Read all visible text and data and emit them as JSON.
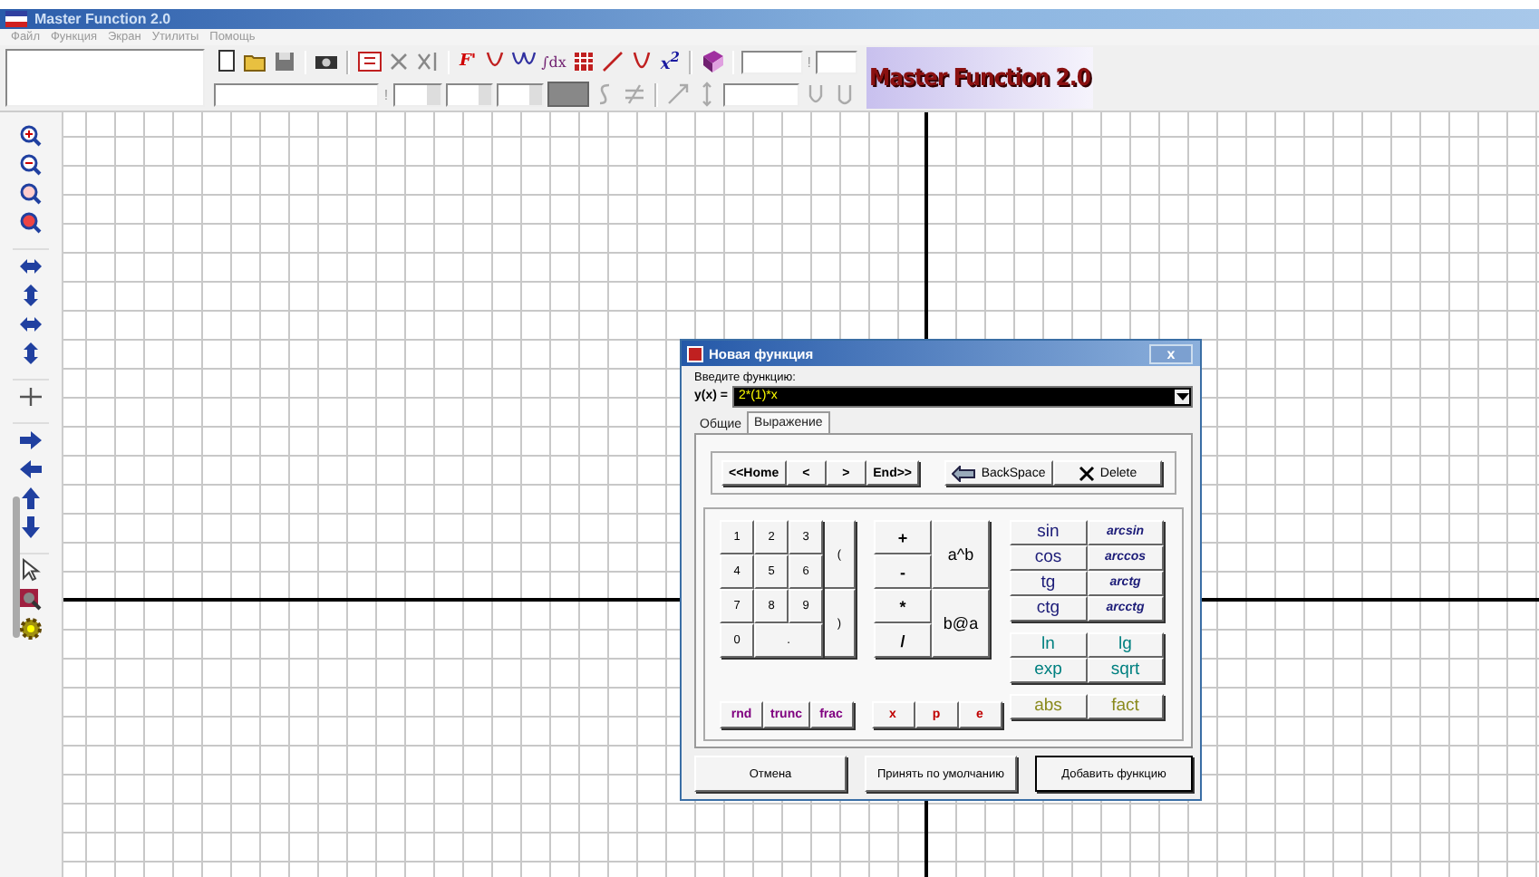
{
  "window": {
    "title": "Master Function 2.0"
  },
  "menu": [
    {
      "label": "Файл"
    },
    {
      "label": "Функция"
    },
    {
      "label": "Экран"
    },
    {
      "label": "Утилиты"
    },
    {
      "label": "Помощь"
    }
  ],
  "toolbar": {
    "derivative_label": "F'",
    "integral_label": "∫dx",
    "power_label": "x$^{2}$",
    "separators": [
      "!",
      "!"
    ],
    "logo": "Master Function 2.0"
  },
  "dialog": {
    "title": "Новая функция",
    "close": "x",
    "prompt": "Введите функцию:",
    "input_label": "y(x) =",
    "input_value": "2*(1)*x",
    "tabs": [
      {
        "label": "Общие",
        "selected": false
      },
      {
        "label": "Выражение",
        "selected": true
      }
    ],
    "nav_buttons": [
      "<<Home",
      "<",
      ">",
      "End>>"
    ],
    "edit_buttons": [
      {
        "label": "BackSpace",
        "kind": "backspace"
      },
      {
        "label": "Delete",
        "kind": "delete"
      }
    ],
    "digits": [
      "1",
      "2",
      "3",
      "4",
      "5",
      "6",
      "7",
      "8",
      "9",
      "0",
      "."
    ],
    "parens": [
      "(",
      ")"
    ],
    "operators": [
      "+",
      "-",
      "*",
      "/"
    ],
    "power_ops": [
      "a^b",
      "b@a"
    ],
    "function_groups": [
      {
        "color": "#1c1c78",
        "items": [
          {
            "label": "sin",
            "italic": false
          },
          {
            "label": "arcsin",
            "italic": true
          },
          {
            "label": "cos",
            "italic": false
          },
          {
            "label": "arccos",
            "italic": true
          },
          {
            "label": "tg",
            "italic": false
          },
          {
            "label": "arctg",
            "italic": true
          },
          {
            "label": "ctg",
            "italic": false
          },
          {
            "label": "arcctg",
            "italic": true
          }
        ]
      },
      {
        "color": "#008080",
        "items": [
          {
            "label": "ln",
            "italic": false
          },
          {
            "label": "lg",
            "italic": false
          },
          {
            "label": "exp",
            "italic": false
          },
          {
            "label": "sqrt",
            "italic": false
          }
        ]
      },
      {
        "color": "#8a8a1c",
        "items": [
          {
            "label": "abs",
            "italic": false
          },
          {
            "label": "fact",
            "italic": false
          }
        ]
      }
    ],
    "special_groups": [
      {
        "color": "#800080",
        "items": [
          "rnd",
          "trunc",
          "frac"
        ]
      },
      {
        "color": "#c00000",
        "items": [
          "x",
          "p",
          "e"
        ]
      }
    ],
    "footer_buttons": [
      {
        "label": "Отмена",
        "default": false
      },
      {
        "label": "Принять по умолчанию",
        "default": false
      },
      {
        "label": "Добавить функцию",
        "default": true
      }
    ]
  }
}
